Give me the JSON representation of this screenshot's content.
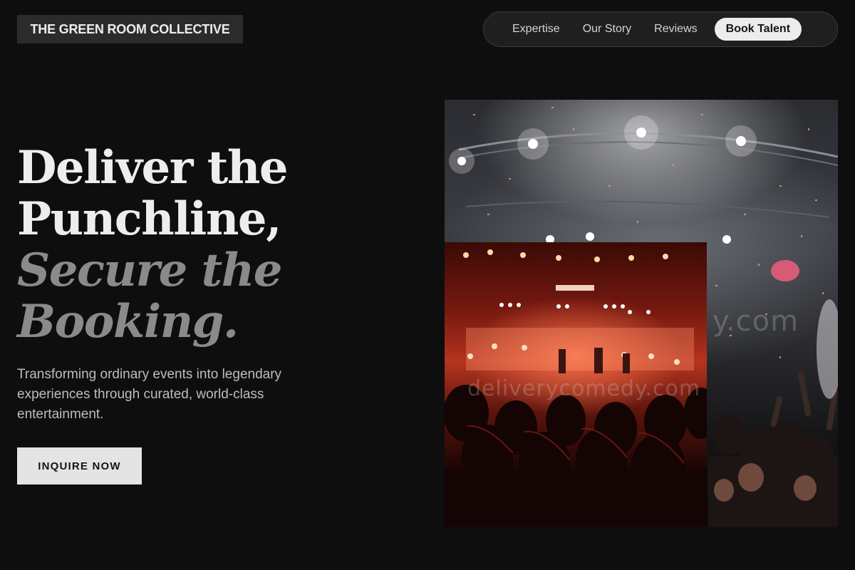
{
  "brand": {
    "name": "THE GREEN ROOM COLLECTIVE"
  },
  "nav": {
    "items": [
      {
        "label": "Expertise"
      },
      {
        "label": "Our Story"
      },
      {
        "label": "Reviews"
      }
    ],
    "cta_label": "Book Talent"
  },
  "hero": {
    "headline_line1": "Deliver the",
    "headline_line2": "Punchline,",
    "headline_line3": "Secure the",
    "headline_line4": "Booking.",
    "subtext": "Transforming ordinary events into legendary experiences through curated, world-class entertainment.",
    "cta_label": "INQUIRE NOW"
  },
  "images": {
    "back_alt": "Concert crowd under stage lights with confetti",
    "front_alt": "Audience silhouettes facing red-lit stage",
    "watermark_front": "deliverycomedy.com",
    "watermark_back": "y.com"
  },
  "colors": {
    "background": "#0e0e0e",
    "headline_primary": "#ededed",
    "headline_secondary": "#8a8a8a",
    "button_bg": "#e4e4e4"
  }
}
